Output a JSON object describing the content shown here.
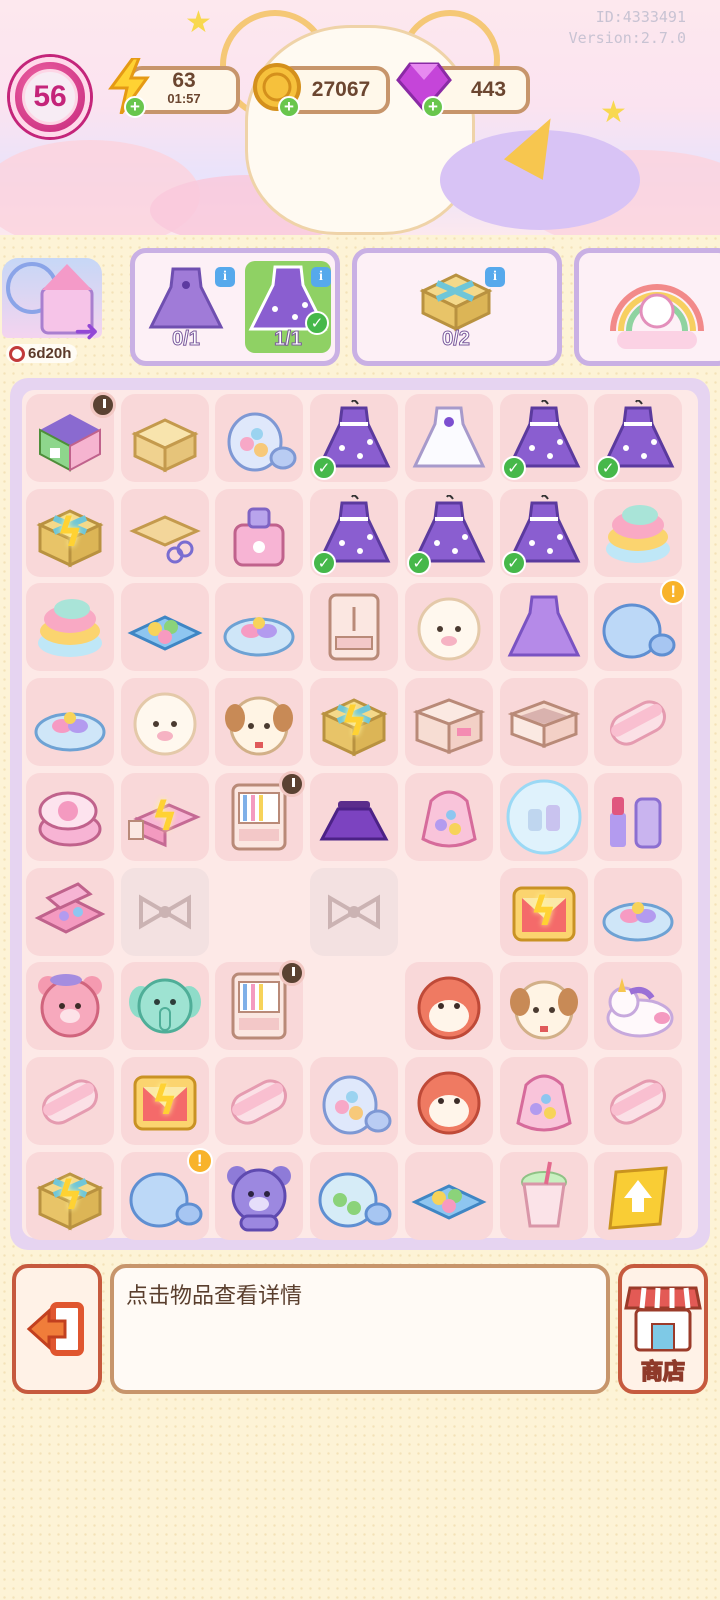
{
  "header": {
    "id_text": "ID:4333491",
    "version_text": "Version:2.7.0",
    "level": "56",
    "energy": {
      "value": "63",
      "timer": "01:57",
      "icon": "lightning-icon"
    },
    "coins": {
      "value": "27067",
      "icon": "coin-icon"
    },
    "gems": {
      "value": "443",
      "icon": "gem-icon"
    }
  },
  "event": {
    "timer": "6d20h",
    "icon": "carnival-castle-icon"
  },
  "orders": [
    {
      "items": [
        {
          "icon": "purple-dress-icon",
          "count": "0/1",
          "done": false
        },
        {
          "icon": "sparkly-purple-dress-icon",
          "count": "1/1",
          "done": true
        }
      ]
    },
    {
      "items": [
        {
          "icon": "gift-box-icon",
          "count": "0/2",
          "done": false
        }
      ]
    },
    {
      "items": [
        {
          "icon": "unicorn-rainbow-icon",
          "count": "",
          "done": false
        }
      ]
    }
  ],
  "board": {
    "rows": [
      [
        "house-shop",
        "paper-box",
        "candy-jar",
        "sparkly-purple-dress",
        "white-dress",
        "sparkly-purple-dress",
        "sparkly-purple-dress"
      ],
      [
        "energy-gift",
        "cardboard-scissors",
        "perfume-bottle",
        "sparkly-purple-dress",
        "sparkly-purple-dress",
        "sparkly-purple-dress",
        "cotton-candy"
      ],
      [
        "cotton-candy",
        "candy-tray",
        "candy-plate",
        "dresser",
        "sheep-plush",
        "purple-dress",
        "glass-jar"
      ],
      [
        "candy-plate",
        "sheep-plush",
        "puppy-plush",
        "energy-gift",
        "nightstand",
        "drawer",
        "marshmallow"
      ],
      [
        "compact",
        "energy-bed",
        "wardrobe",
        "purple-skirt",
        "candy-bag",
        "cosmetic-bubble",
        "lipstick-set"
      ],
      [
        "eyeshadow-palette",
        "locked-bow",
        "empty",
        "locked-bow",
        "empty",
        "energy-stage",
        "candy-plate"
      ],
      [
        "pink-bear",
        "teal-elephant",
        "wardrobe",
        "empty",
        "hamster",
        "puppy-plush",
        "unicorn-plush"
      ],
      [
        "marshmallow",
        "energy-stage",
        "marshmallow",
        "candy-jar",
        "hamster",
        "candy-bag",
        "marshmallow"
      ],
      [
        "energy-gift",
        "glass-jar",
        "purple-bear",
        "glass-jar-green",
        "candy-tray",
        "milkshake",
        "upgrade-card"
      ]
    ]
  },
  "footer": {
    "info_text": "点击物品查看详情",
    "shop_label": "商店",
    "exit_icon": "exit-door-icon",
    "shop_icon": "shop-awning-icon"
  },
  "colors": {
    "board_bg": "#fde9e7",
    "board_border": "#e6d4f1",
    "panel_border": "#c7956b",
    "accent_red": "#c65a3e"
  }
}
